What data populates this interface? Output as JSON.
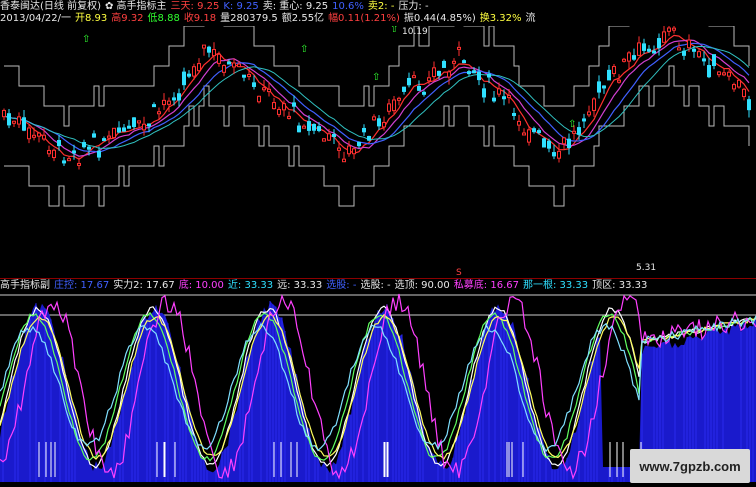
{
  "header": {
    "line1": [
      {
        "text": "香泰闽达(日线 前复权)",
        "color": "white"
      },
      {
        "text": "✿ 高手指标主",
        "color": "white"
      },
      {
        "text": "三天: 9.25",
        "color": "red"
      },
      {
        "text": "K: 9.25",
        "color": "blue"
      },
      {
        "text": "卖: 重心: 9.25",
        "color": "white"
      },
      {
        "text": "10.6%",
        "color": "blue"
      },
      {
        "text": "卖2: -",
        "color": "yellow"
      },
      {
        "text": "压力: -",
        "color": "white"
      }
    ],
    "line2": [
      {
        "text": "2013/04/22/一",
        "color": "white"
      },
      {
        "text": "开8.93",
        "color": "yellow"
      },
      {
        "text": "高9.32",
        "color": "red"
      },
      {
        "text": "低8.88",
        "color": "green"
      },
      {
        "text": "收9.18",
        "color": "red"
      },
      {
        "text": "量280379.5",
        "color": "white"
      },
      {
        "text": "额2.55亿",
        "color": "white"
      },
      {
        "text": "幅0.11(1.21%)",
        "color": "red"
      },
      {
        "text": "振0.44(4.85%)",
        "color": "white"
      },
      {
        "text": "换3.32%",
        "color": "yellow"
      },
      {
        "text": "流",
        "color": "white"
      }
    ]
  },
  "price_labels": {
    "high": "10.19",
    "low": "5.31"
  },
  "separator_label": "S",
  "sub_header": [
    {
      "text": "高手指标副",
      "color": "white"
    },
    {
      "text": "庄控: 17.67",
      "color": "blue"
    },
    {
      "text": "实力2: 17.67",
      "color": "white"
    },
    {
      "text": "底: 10.00",
      "color": "mag"
    },
    {
      "text": "近: 33.33",
      "color": "cyan"
    },
    {
      "text": "远: 33.33",
      "color": "white"
    },
    {
      "text": "选股: -",
      "color": "blue"
    },
    {
      "text": "选股: -",
      "color": "white"
    },
    {
      "text": "选顶: 90.00",
      "color": "white"
    },
    {
      "text": "私募底: 16.67",
      "color": "mag"
    },
    {
      "text": "那一根: 33.33",
      "color": "cyan"
    },
    {
      "text": "顶区: 33.33",
      "color": "white"
    }
  ],
  "watermark": "www.7gpzb.com",
  "colors": {
    "bg": "#000000",
    "up": "#ff3030",
    "down": "#30e0ff",
    "blue_fill": "#1a1acc"
  }
}
